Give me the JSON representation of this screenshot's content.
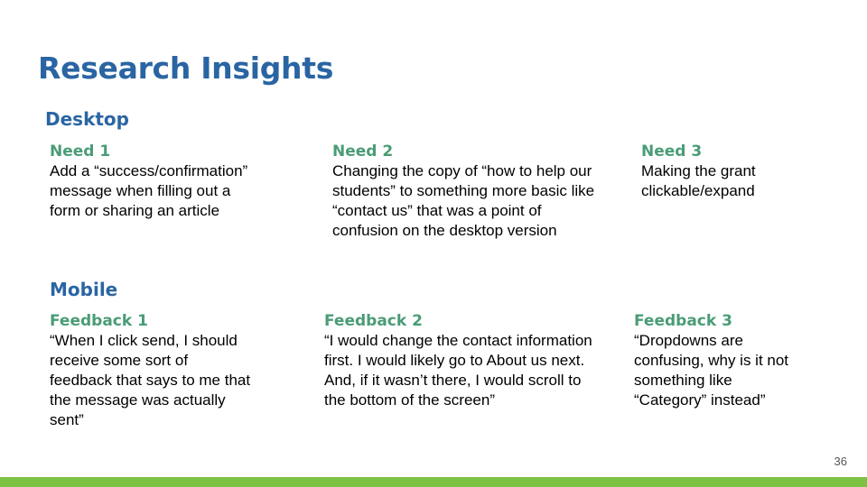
{
  "slide": {
    "title": "Research Insights",
    "page_number": "36",
    "colors": {
      "title": "#2a65a3",
      "heading_green": "#4a9c76",
      "bottom_bar": "#7cc243"
    }
  },
  "desktop": {
    "heading": "Desktop",
    "items": [
      {
        "label": "Need 1",
        "text": "Add a “success/confirmation” message when filling out a form or sharing an article"
      },
      {
        "label": "Need 2",
        "text": "Changing the copy of “how to help our students” to something more basic like “contact us” that was a point of confusion on the desktop version"
      },
      {
        "label": "Need 3",
        "text": "Making the grant clickable/expand"
      }
    ]
  },
  "mobile": {
    "heading": "Mobile",
    "items": [
      {
        "label": "Feedback 1",
        "text": "“When I click send, I should receive some sort of feedback that says to me that the message was actually sent”"
      },
      {
        "label": "Feedback 2",
        "text": "“I would change the contact information first. I would likely go to About us next. And, if it wasn’t there, I would scroll to the bottom of the screen”"
      },
      {
        "label": "Feedback 3",
        "text": "“Dropdowns are confusing, why is it not something like “Category” instead”"
      }
    ]
  }
}
